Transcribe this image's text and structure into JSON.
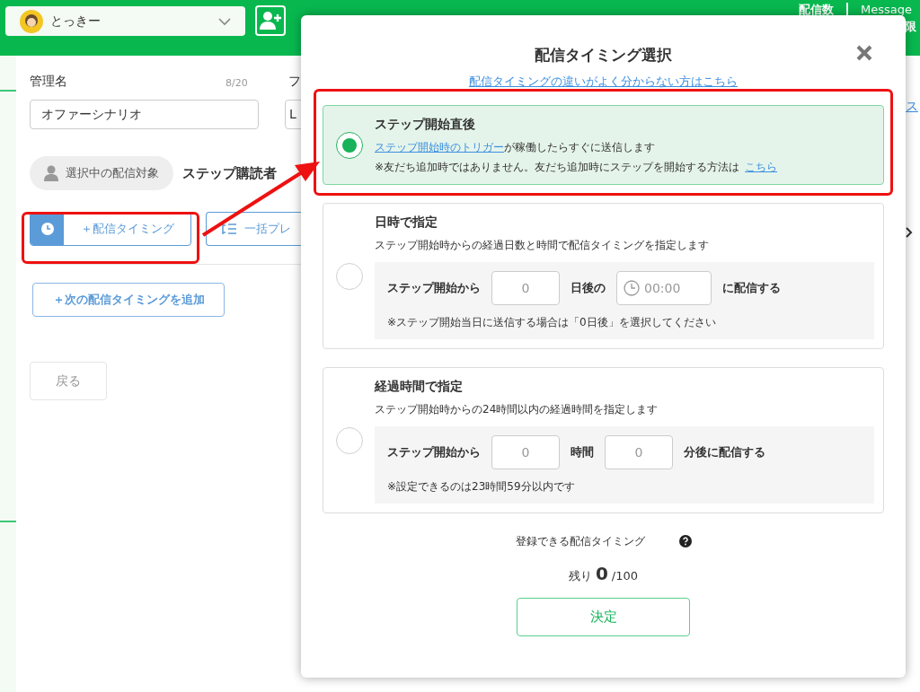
{
  "header": {
    "account": "とっきー",
    "stats": [
      "配信数",
      "Message",
      "限"
    ]
  },
  "form": {
    "name_label": "管理名",
    "name_count": "8/20",
    "name_value": "オファーシナリオ",
    "second_label": "フ",
    "second_value": "L"
  },
  "target": {
    "label": "選択中の配信対象",
    "value": "ステップ購読者"
  },
  "toolbar": [
    {
      "kind": "timing",
      "label": "＋配信タイミング"
    },
    {
      "kind": "preview",
      "label": "一括プレ"
    }
  ],
  "add_button": "＋次の配信タイミングを追加",
  "back_button": "戻る",
  "side_link": "ス",
  "modal": {
    "title": "配信タイミング選択",
    "help_link": "配信タイミングの違いがよく分からない方はこちら",
    "options": [
      {
        "kind": "immediate",
        "selected": true,
        "title": "ステップ開始直後",
        "link": "ステップ開始時のトリガー",
        "text": "が稼働したらすぐに送信します",
        "note": "※友だち追加時ではありません。友だち追加時にステップを開始する方法は",
        "note_link": "こちら"
      },
      {
        "kind": "schedule",
        "selected": false,
        "title": "日時で指定",
        "text": "ステップ開始時からの経過日数と時間で配信タイミングを指定します",
        "inputs": [
          {
            "kind": "text",
            "text": "ステップ開始から"
          },
          {
            "kind": "number",
            "placeholder": "0"
          },
          {
            "kind": "text",
            "text": "日後の"
          },
          {
            "kind": "time",
            "placeholder": "00:00"
          },
          {
            "kind": "text",
            "text": "に配信する"
          }
        ],
        "note": "※ステップ開始当日に送信する場合は「0日後」を選択してください"
      },
      {
        "kind": "schedule",
        "selected": false,
        "title": "経過時間で指定",
        "text": "ステップ開始時からの24時間以内の経過時間を指定します",
        "inputs": [
          {
            "kind": "text",
            "text": "ステップ開始から"
          },
          {
            "kind": "number",
            "placeholder": "0"
          },
          {
            "kind": "text",
            "text": "時間"
          },
          {
            "kind": "number",
            "placeholder": "0"
          },
          {
            "kind": "text",
            "text": "分後に配信する"
          }
        ],
        "note": "※設定できるのは23時間59分以内です"
      }
    ],
    "quota_label": "登録できる配信タイミング",
    "remaining_prefix": "残り",
    "remaining_count": "0",
    "remaining_total": "/100",
    "confirm": "決定"
  }
}
